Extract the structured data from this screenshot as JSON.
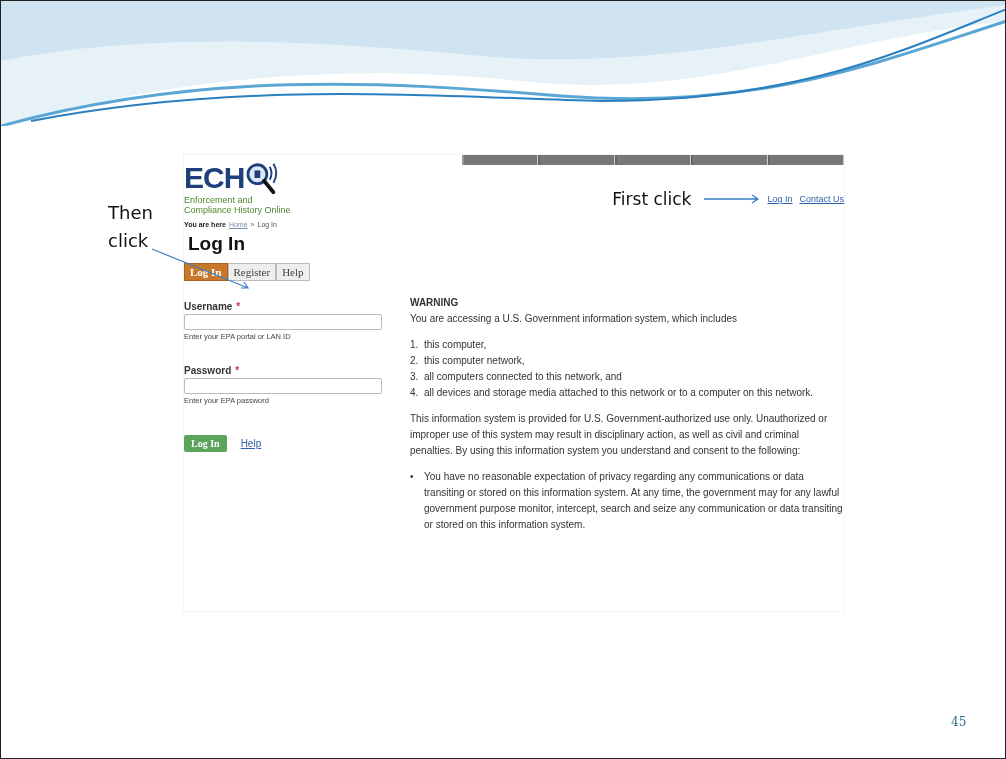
{
  "annotations": [
    {
      "kind": "then",
      "text": "Then click"
    },
    {
      "kind": "first",
      "text": "First click"
    }
  ],
  "page": {
    "logo": {
      "letters": "ECH",
      "tagline": "Enforcement and Compliance History Online"
    },
    "breadcrumb": {
      "label": "You are here",
      "items": [
        {
          "text": "Home",
          "kind": "link"
        },
        {
          "text": "»",
          "kind": "separator"
        },
        {
          "text": "Log In",
          "kind": "current"
        }
      ]
    },
    "top_links": [
      "Log In",
      "Contact Us"
    ],
    "heading": "Log In",
    "tabs": [
      {
        "label": "Log In",
        "selected": true
      },
      {
        "label": "Register",
        "selected": false
      },
      {
        "label": "Help",
        "selected": false
      }
    ],
    "fields": [
      {
        "label": "Username",
        "required_mark": "*",
        "hint": "Enter your EPA portal or LAN ID"
      },
      {
        "label": "Password",
        "required_mark": "*",
        "hint": "Enter your EPA password"
      }
    ],
    "submit": "Log In",
    "help_link": "Help",
    "warning": {
      "title": "WARNING",
      "intro": "You are accessing a U.S. Government information system, which includes",
      "items": [
        {
          "marker": "1.",
          "text": "this computer,"
        },
        {
          "marker": "2.",
          "text": "this computer network,"
        },
        {
          "marker": "3.",
          "text": "all computers connected to this network, and"
        },
        {
          "marker": "4.",
          "text": "all devices and storage media attached to this network or to a computer on this network."
        }
      ],
      "paragraph": "This information system is provided for U.S. Government-authorized use only. Unauthorized or improper use of this system may result in disciplinary action, as well as civil and criminal penalties. By using this information system you understand and consent to the following:",
      "bullets": [
        {
          "marker": "•",
          "text": "You have no reasonable expectation of privacy regarding any communications or data transiting or stored on this information system. At any time, the government may for any lawful government purpose monitor, intercept, search and seize any communication or data transiting or stored on this information system."
        }
      ]
    }
  },
  "slide": {
    "page_number": "45"
  }
}
